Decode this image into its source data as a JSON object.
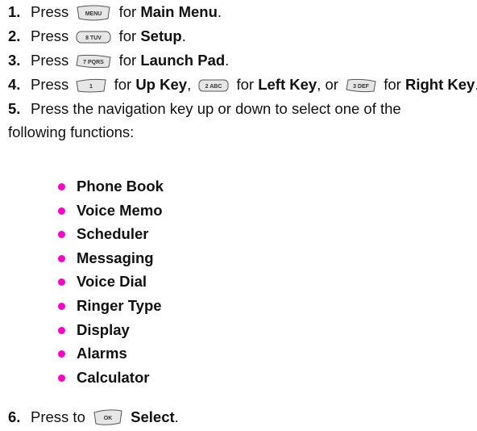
{
  "steps": [
    {
      "num": "1.",
      "pre": "Press",
      "keys": [
        {
          "label": "MENU",
          "after": "for",
          "target": "Main Menu",
          "sep": "."
        }
      ]
    },
    {
      "num": "2.",
      "pre": "Press",
      "keys": [
        {
          "label": "8 TUV",
          "after": "for",
          "target": "Setup",
          "sep": "."
        }
      ]
    },
    {
      "num": "3.",
      "pre": "Press",
      "keys": [
        {
          "label": "7 PQRS",
          "after": "for",
          "target": "Launch Pad",
          "sep": "."
        }
      ]
    },
    {
      "num": "4.",
      "pre": "Press",
      "keys": [
        {
          "label": "1",
          "after": "for",
          "target": "Up Key",
          "sep": ","
        },
        {
          "label": "2 ABC",
          "after": "for",
          "target": "Left Key",
          "sep": ", or"
        },
        {
          "label": "3 DEF",
          "after": "for",
          "target": "Right Key",
          "sep": "."
        }
      ]
    },
    {
      "num": "5.",
      "text": "Press the navigation key up or down to select one of the following functions:"
    },
    {
      "num": "6.",
      "pre": "Press to",
      "keys": [
        {
          "label": "OK",
          "after": "",
          "target": "Select",
          "sep": "."
        }
      ]
    }
  ],
  "functions": [
    "Phone Book",
    "Voice Memo",
    "Scheduler",
    "Messaging",
    "Voice Dial",
    "Ringer Type",
    "Display",
    "Alarms",
    "Calculator"
  ],
  "colors": {
    "bullet": "#ff00cc",
    "key_fill": "#e6e6e6",
    "key_stroke": "#555555"
  }
}
